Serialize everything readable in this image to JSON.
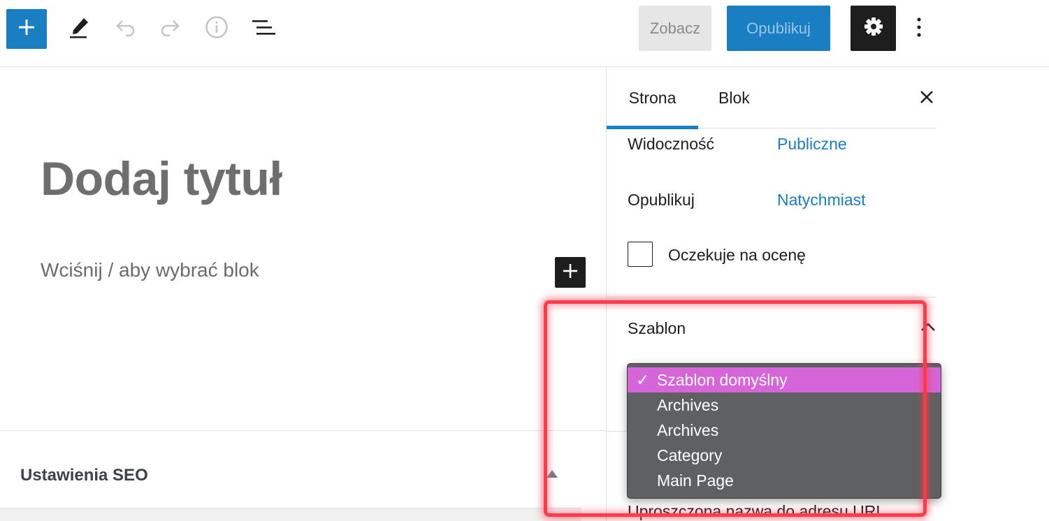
{
  "toolbar": {
    "inserter_icon": "plus-icon",
    "tools_icon": "pencil-icon",
    "undo_icon": "undo-icon",
    "redo_icon": "redo-icon",
    "info_icon": "info-icon",
    "list_view_icon": "list-view-icon",
    "preview_label": "Zobacz",
    "publish_label": "Opublikuj",
    "settings_icon": "gear-icon",
    "more_icon": "vertical-ellipsis-icon"
  },
  "editor": {
    "title_placeholder": "Dodaj tytuł",
    "block_placeholder": "Wciśnij / aby wybrać blok",
    "block_inserter_icon": "plus-icon"
  },
  "seo_panel": {
    "title": "Ustawienia SEO",
    "toggle_icon": "triangle-up-icon"
  },
  "sidebar": {
    "tabs": [
      {
        "label": "Strona",
        "active": true
      },
      {
        "label": "Blok",
        "active": false
      }
    ],
    "close_icon": "close-icon",
    "visibility": {
      "label": "Widoczność",
      "value": "Publiczne"
    },
    "publish": {
      "label": "Opublikuj",
      "value": "Natychmiast"
    },
    "pending_review": {
      "label": "Oczekuje na ocenę",
      "checked": false
    },
    "template": {
      "title": "Szablon",
      "chevron_icon": "chevron-up-icon",
      "options": [
        {
          "label": "Szablon domyślny",
          "selected": true
        },
        {
          "label": "Archives",
          "selected": false
        },
        {
          "label": "Archives",
          "selected": false
        },
        {
          "label": "Category",
          "selected": false
        },
        {
          "label": "Main Page",
          "selected": false
        }
      ]
    },
    "slug_label": "Uproszczona nazwa do adresu URL"
  },
  "colors": {
    "accent": "#1a7ec3",
    "dark": "#1e1e1e",
    "selected_option": "#d565d8",
    "dropdown_bg": "#5e6062",
    "highlight": "#ff3b4a"
  }
}
